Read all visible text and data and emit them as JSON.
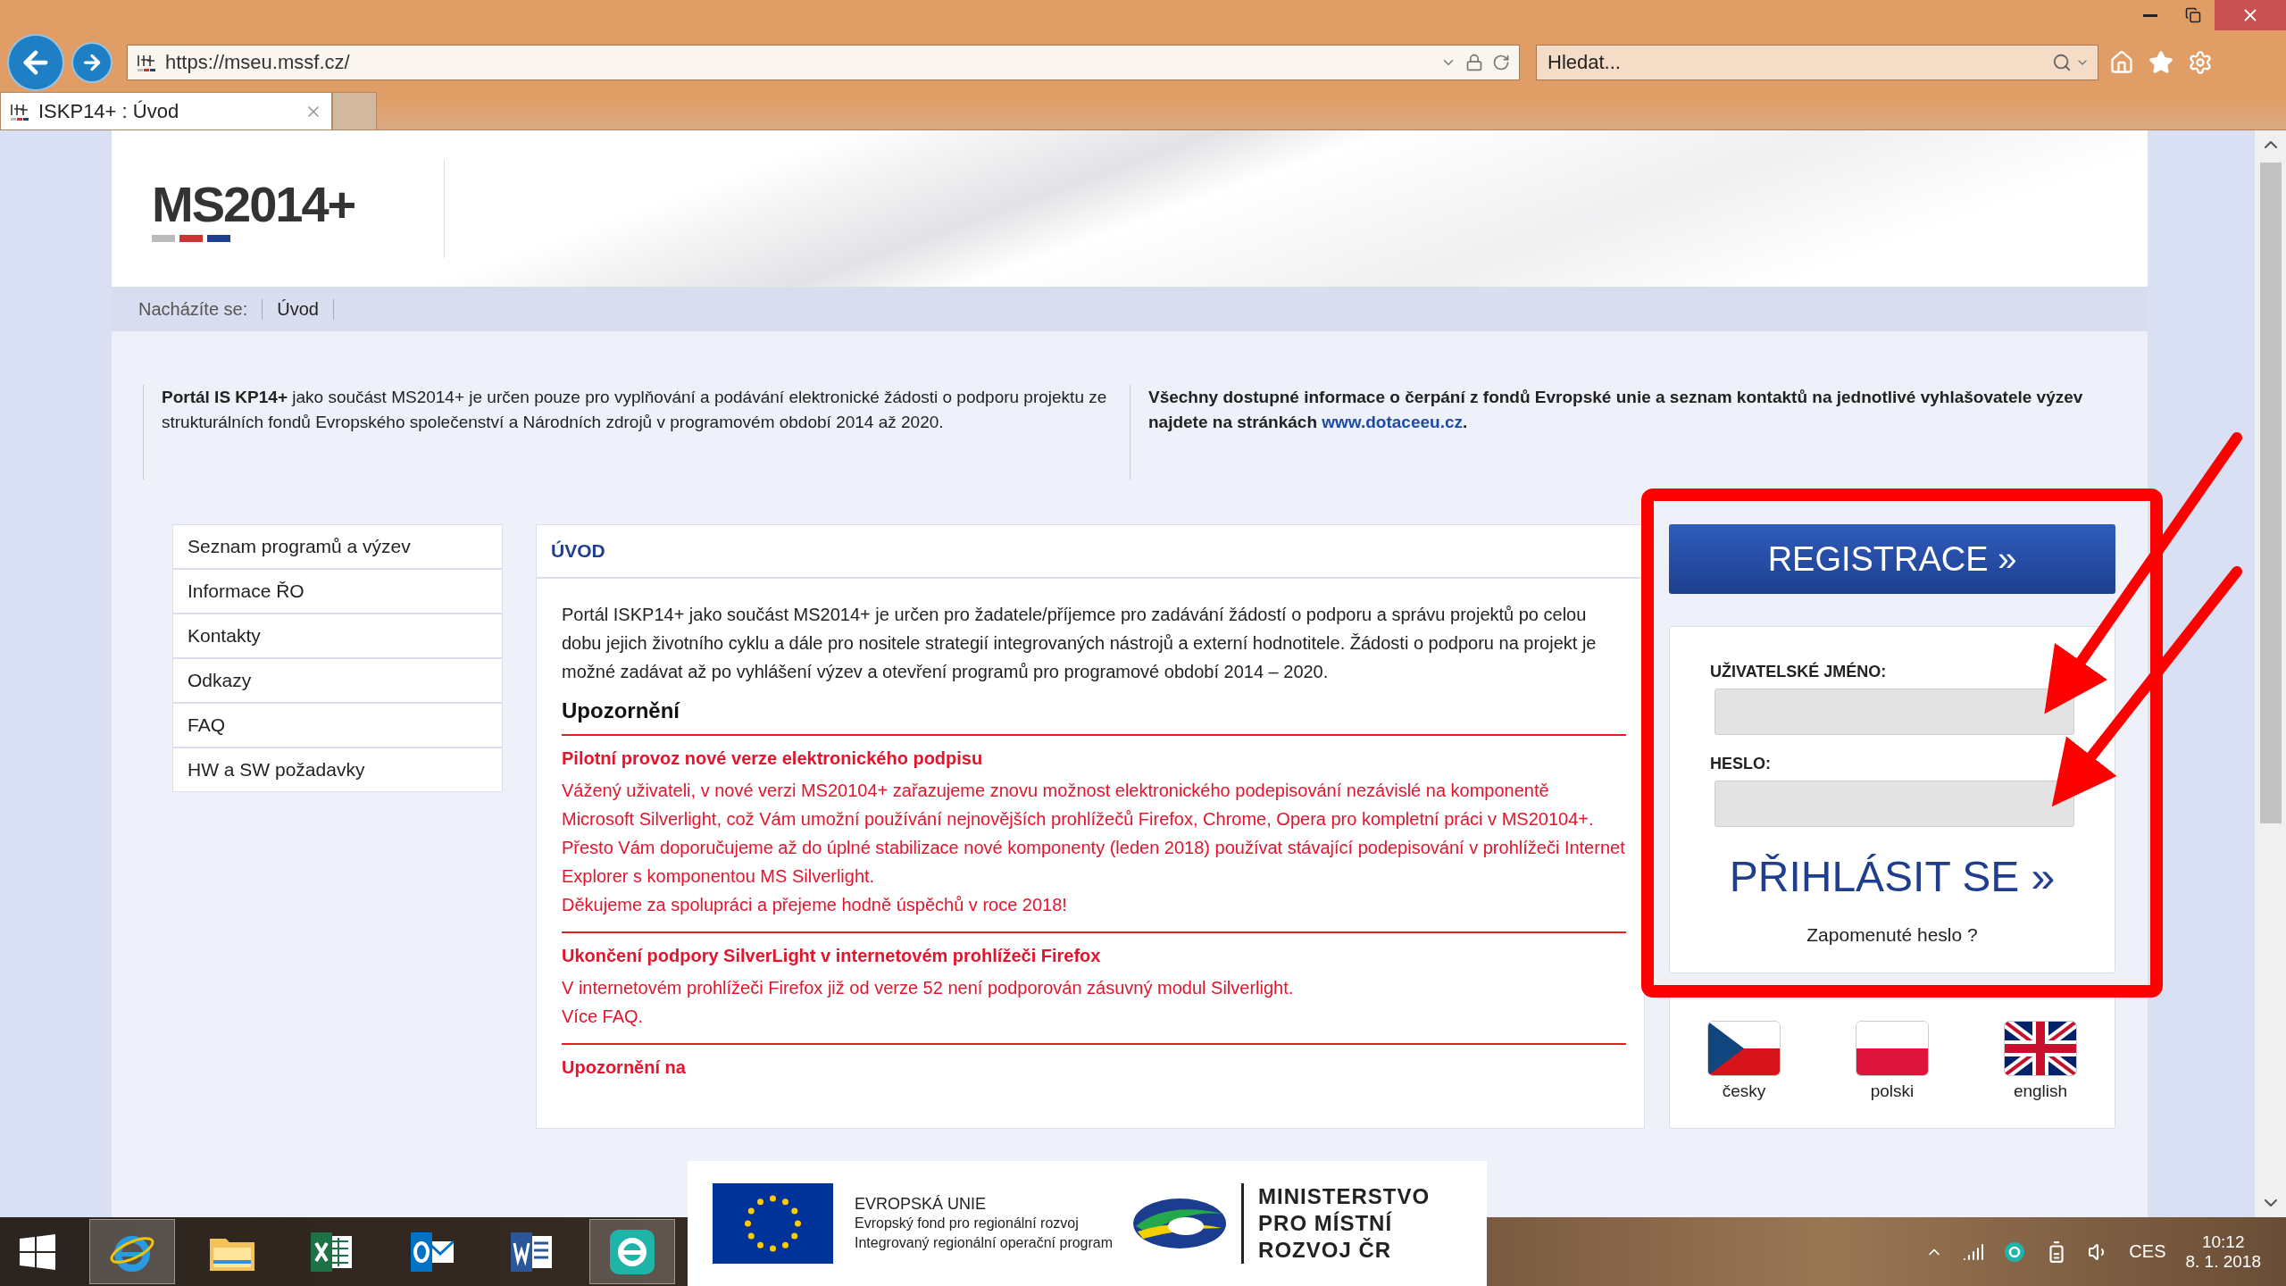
{
  "browser": {
    "address": "https://mseu.mssf.cz/",
    "search_placeholder": "Hledat...",
    "tabs": [
      {
        "title": "ISKP14+ : Úvod",
        "selected": true
      }
    ]
  },
  "header": {
    "logo": "MS2014+"
  },
  "breadcrumb": {
    "label": "Nacházíte se:",
    "items": [
      "Úvod"
    ]
  },
  "info": [
    {
      "text": "**Portál IS KP14+** jako součást MS2014+ je určen pouze pro vyplňování a podávání elektronické žádosti o podporu projektu ze strukturálních fondů Evropského společenství a Národních zdrojů v programovém období 2014 až 2020."
    },
    {
      "text": "Všechny dostupné informace o čerpání z fondů Evropské unie a seznam kontaktů na jednotlivé vyhlašovatele výzev najdete na stránkách",
      "link": "www.dotaceeu.cz",
      "end": "."
    }
  ],
  "menu": [
    "Seznam programů a výzev",
    "Informace ŘO",
    "Kontakty",
    "Odkazy",
    "FAQ",
    "HW a SW požadavky"
  ],
  "main": {
    "title": "ÚVOD",
    "intro": "Portál ISKP14+ jako součást MS2014+ je určen pro žadatele/příjemce pro zadávání žádostí o podporu a správu projektů po celou dobu jejich životního cyklu a dále pro nositele strategií integrovaných nástrojů a externí hodnotitele. Žádosti o podporu na projekt je možné zadávat až po vyhlášení výzev a otevření programů pro programové období 2014 – 2020.",
    "section_title": "Upozornění",
    "notices": [
      {
        "title": "Pilotní provoz nové verze elektronického podpisu",
        "lines": [
          "Vážený uživateli, v nové verzi MS20104+ zařazujeme znovu možnost elektronického podepisování nezávislé na komponentě Microsoft Silverlight, což Vám umožní používání nejnovějších prohlížečů Firefox, Chrome, Opera pro kompletní práci v MS20104+.",
          "Přesto Vám doporučujeme až do úplné stabilizace nové komponenty (leden 2018) používat stávající podepisování v prohlížeči Internet Explorer s komponentou MS Silverlight.",
          "Děkujeme za spolupráci a přejeme hodně úspěchů v roce 2018!"
        ]
      },
      {
        "title": "Ukončení podpory SilverLight v internetovém prohlížeči Firefox",
        "lines": [
          "V internetovém prohlížeči Firefox již od verze 52 není podporován zásuvný modul Silverlight.",
          "Více FAQ."
        ]
      },
      {
        "title": "Upozornění na"
      }
    ]
  },
  "login": {
    "register": "REGISTRACE »",
    "username_label": "UŽIVATELSKÉ JMÉNO:",
    "password_label": "HESLO:",
    "submit": "PŘIHLÁSIT SE »",
    "forgot": "Zapomenuté heslo ?"
  },
  "languages": [
    {
      "kind": "cz",
      "label": "česky"
    },
    {
      "kind": "pl",
      "label": "polski"
    },
    {
      "kind": "uk",
      "label": "english"
    }
  ],
  "banner": {
    "eu_lines": [
      "EVROPSKÁ UNIE",
      "Evropský fond pro regionální rozvoj",
      "Integrovaný regionální operační program"
    ],
    "ministry_lines": [
      "MINISTERSTVO",
      "PRO MÍSTNÍ",
      "ROZVOJ ČR"
    ]
  },
  "taskbar": {
    "apps": [
      {
        "kind": "start",
        "active": false
      },
      {
        "kind": "ie",
        "active": true
      },
      {
        "kind": "explorer",
        "active": false
      },
      {
        "kind": "excel",
        "active": false
      },
      {
        "kind": "outlook",
        "active": false
      },
      {
        "kind": "word",
        "active": false
      },
      {
        "kind": "eset",
        "active": true
      }
    ],
    "language": "CES",
    "time": "10:12",
    "date": "8. 1. 2018"
  }
}
